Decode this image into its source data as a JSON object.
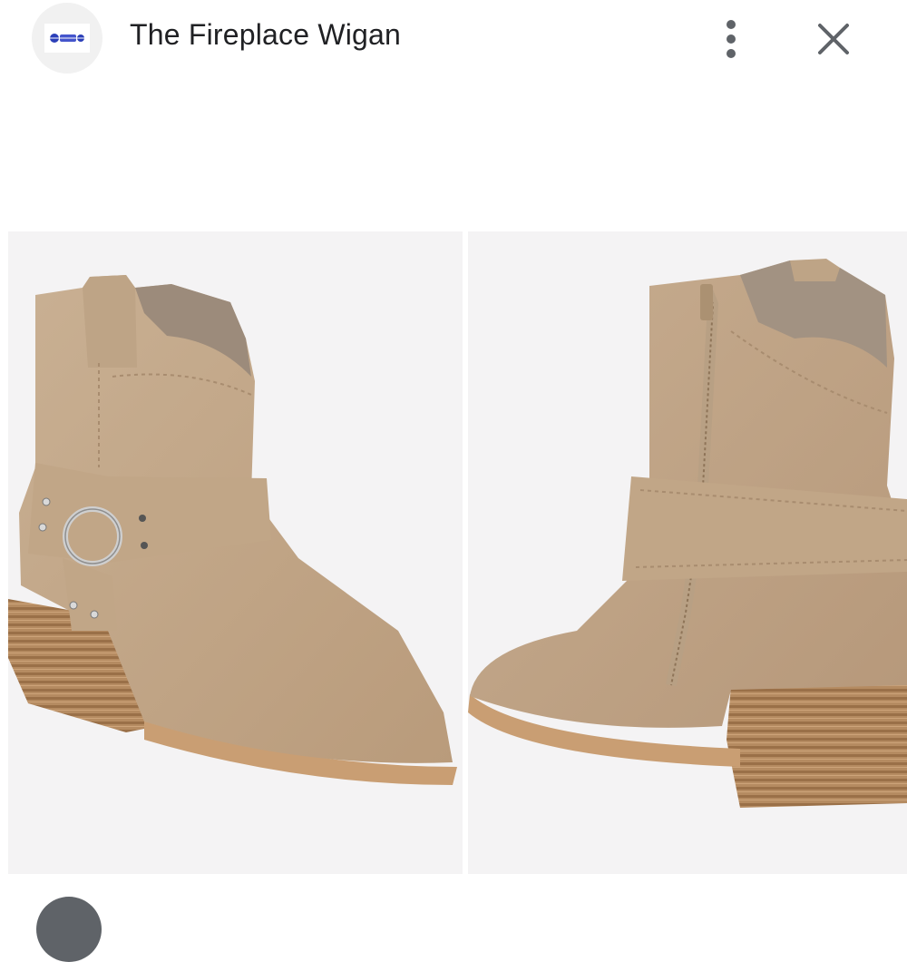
{
  "header": {
    "site_name": "The Fireplace Wigan",
    "site_icon": "site-logo-icon",
    "more_icon": "more-vert-icon",
    "close_icon": "close-icon"
  },
  "image": {
    "left_view": "boot-outer-side-harness",
    "right_view": "boot-inner-side-zip"
  },
  "colors": {
    "suede": "#c4a98a",
    "heel_wood": "#a77d55",
    "sole": "#c99e73",
    "panel_bg": "#f4f3f4",
    "title_text": "#202124",
    "icon_gray": "#5f6368"
  }
}
